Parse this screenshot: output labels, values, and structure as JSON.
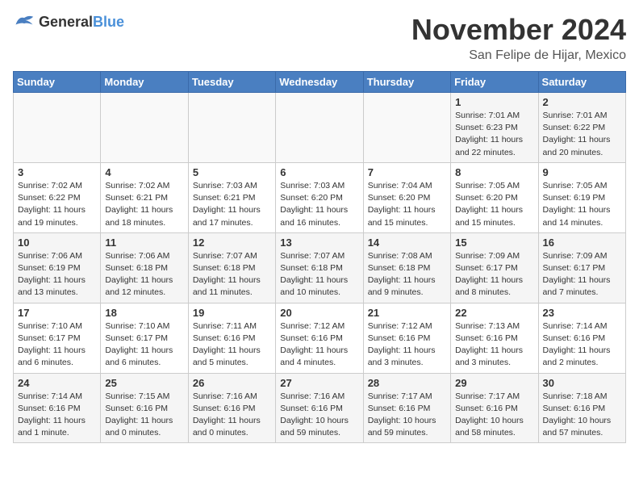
{
  "logo": {
    "general": "General",
    "blue": "Blue"
  },
  "title": "November 2024",
  "location": "San Felipe de Hijar, Mexico",
  "days_of_week": [
    "Sunday",
    "Monday",
    "Tuesday",
    "Wednesday",
    "Thursday",
    "Friday",
    "Saturday"
  ],
  "weeks": [
    [
      {
        "day": "",
        "info": ""
      },
      {
        "day": "",
        "info": ""
      },
      {
        "day": "",
        "info": ""
      },
      {
        "day": "",
        "info": ""
      },
      {
        "day": "",
        "info": ""
      },
      {
        "day": "1",
        "info": "Sunrise: 7:01 AM\nSunset: 6:23 PM\nDaylight: 11 hours and 22 minutes."
      },
      {
        "day": "2",
        "info": "Sunrise: 7:01 AM\nSunset: 6:22 PM\nDaylight: 11 hours and 20 minutes."
      }
    ],
    [
      {
        "day": "3",
        "info": "Sunrise: 7:02 AM\nSunset: 6:22 PM\nDaylight: 11 hours and 19 minutes."
      },
      {
        "day": "4",
        "info": "Sunrise: 7:02 AM\nSunset: 6:21 PM\nDaylight: 11 hours and 18 minutes."
      },
      {
        "day": "5",
        "info": "Sunrise: 7:03 AM\nSunset: 6:21 PM\nDaylight: 11 hours and 17 minutes."
      },
      {
        "day": "6",
        "info": "Sunrise: 7:03 AM\nSunset: 6:20 PM\nDaylight: 11 hours and 16 minutes."
      },
      {
        "day": "7",
        "info": "Sunrise: 7:04 AM\nSunset: 6:20 PM\nDaylight: 11 hours and 15 minutes."
      },
      {
        "day": "8",
        "info": "Sunrise: 7:05 AM\nSunset: 6:20 PM\nDaylight: 11 hours and 15 minutes."
      },
      {
        "day": "9",
        "info": "Sunrise: 7:05 AM\nSunset: 6:19 PM\nDaylight: 11 hours and 14 minutes."
      }
    ],
    [
      {
        "day": "10",
        "info": "Sunrise: 7:06 AM\nSunset: 6:19 PM\nDaylight: 11 hours and 13 minutes."
      },
      {
        "day": "11",
        "info": "Sunrise: 7:06 AM\nSunset: 6:18 PM\nDaylight: 11 hours and 12 minutes."
      },
      {
        "day": "12",
        "info": "Sunrise: 7:07 AM\nSunset: 6:18 PM\nDaylight: 11 hours and 11 minutes."
      },
      {
        "day": "13",
        "info": "Sunrise: 7:07 AM\nSunset: 6:18 PM\nDaylight: 11 hours and 10 minutes."
      },
      {
        "day": "14",
        "info": "Sunrise: 7:08 AM\nSunset: 6:18 PM\nDaylight: 11 hours and 9 minutes."
      },
      {
        "day": "15",
        "info": "Sunrise: 7:09 AM\nSunset: 6:17 PM\nDaylight: 11 hours and 8 minutes."
      },
      {
        "day": "16",
        "info": "Sunrise: 7:09 AM\nSunset: 6:17 PM\nDaylight: 11 hours and 7 minutes."
      }
    ],
    [
      {
        "day": "17",
        "info": "Sunrise: 7:10 AM\nSunset: 6:17 PM\nDaylight: 11 hours and 6 minutes."
      },
      {
        "day": "18",
        "info": "Sunrise: 7:10 AM\nSunset: 6:17 PM\nDaylight: 11 hours and 6 minutes."
      },
      {
        "day": "19",
        "info": "Sunrise: 7:11 AM\nSunset: 6:16 PM\nDaylight: 11 hours and 5 minutes."
      },
      {
        "day": "20",
        "info": "Sunrise: 7:12 AM\nSunset: 6:16 PM\nDaylight: 11 hours and 4 minutes."
      },
      {
        "day": "21",
        "info": "Sunrise: 7:12 AM\nSunset: 6:16 PM\nDaylight: 11 hours and 3 minutes."
      },
      {
        "day": "22",
        "info": "Sunrise: 7:13 AM\nSunset: 6:16 PM\nDaylight: 11 hours and 3 minutes."
      },
      {
        "day": "23",
        "info": "Sunrise: 7:14 AM\nSunset: 6:16 PM\nDaylight: 11 hours and 2 minutes."
      }
    ],
    [
      {
        "day": "24",
        "info": "Sunrise: 7:14 AM\nSunset: 6:16 PM\nDaylight: 11 hours and 1 minute."
      },
      {
        "day": "25",
        "info": "Sunrise: 7:15 AM\nSunset: 6:16 PM\nDaylight: 11 hours and 0 minutes."
      },
      {
        "day": "26",
        "info": "Sunrise: 7:16 AM\nSunset: 6:16 PM\nDaylight: 11 hours and 0 minutes."
      },
      {
        "day": "27",
        "info": "Sunrise: 7:16 AM\nSunset: 6:16 PM\nDaylight: 10 hours and 59 minutes."
      },
      {
        "day": "28",
        "info": "Sunrise: 7:17 AM\nSunset: 6:16 PM\nDaylight: 10 hours and 59 minutes."
      },
      {
        "day": "29",
        "info": "Sunrise: 7:17 AM\nSunset: 6:16 PM\nDaylight: 10 hours and 58 minutes."
      },
      {
        "day": "30",
        "info": "Sunrise: 7:18 AM\nSunset: 6:16 PM\nDaylight: 10 hours and 57 minutes."
      }
    ]
  ]
}
